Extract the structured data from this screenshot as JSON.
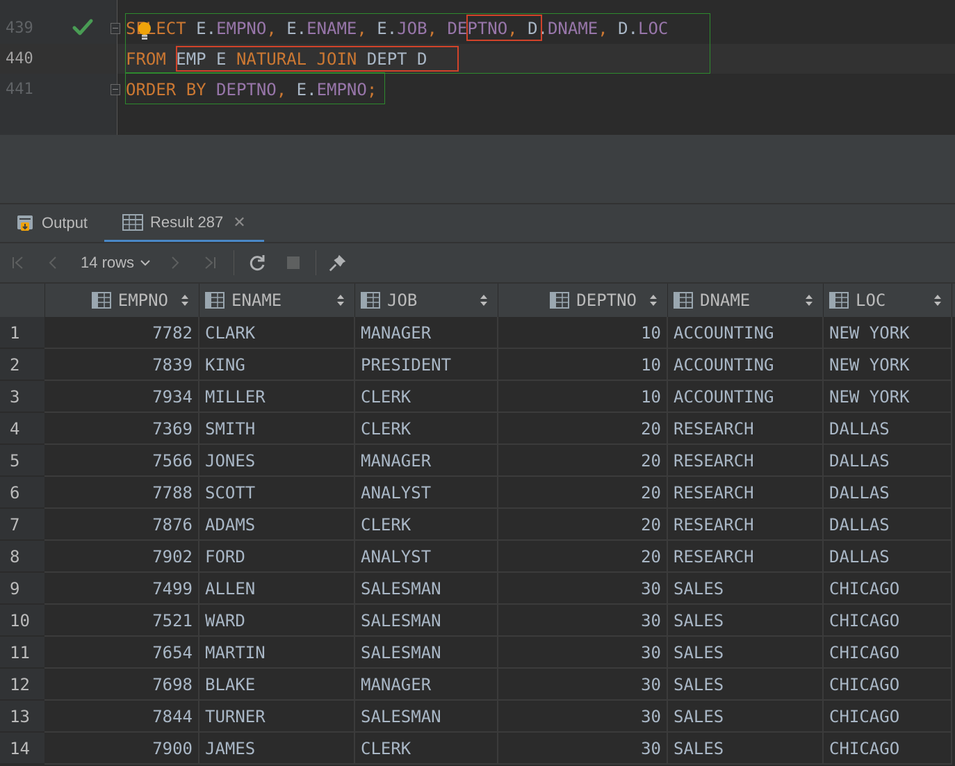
{
  "editor": {
    "line_numbers": [
      "439",
      "440",
      "441"
    ],
    "current_line": "440",
    "code": {
      "line1": [
        {
          "t": "SELECT",
          "c": "kw"
        },
        {
          "t": " ",
          "c": "plain"
        },
        {
          "t": "E",
          "c": "plain"
        },
        {
          "t": ".",
          "c": "plain"
        },
        {
          "t": "EMPNO",
          "c": "id"
        },
        {
          "t": ", ",
          "c": "kw"
        },
        {
          "t": "E",
          "c": "plain"
        },
        {
          "t": ".",
          "c": "plain"
        },
        {
          "t": "ENAME",
          "c": "id"
        },
        {
          "t": ", ",
          "c": "kw"
        },
        {
          "t": "E",
          "c": "plain"
        },
        {
          "t": ".",
          "c": "plain"
        },
        {
          "t": "JOB",
          "c": "id"
        },
        {
          "t": ", ",
          "c": "kw"
        },
        {
          "t": "DEPTNO",
          "c": "id"
        },
        {
          "t": ", ",
          "c": "kw"
        },
        {
          "t": "D",
          "c": "plain"
        },
        {
          "t": ".",
          "c": "plain"
        },
        {
          "t": "DNAME",
          "c": "id"
        },
        {
          "t": ", ",
          "c": "kw"
        },
        {
          "t": "D",
          "c": "plain"
        },
        {
          "t": ".",
          "c": "plain"
        },
        {
          "t": "LOC",
          "c": "id"
        }
      ],
      "line2": [
        {
          "t": "FROM",
          "c": "kw"
        },
        {
          "t": " ",
          "c": "plain"
        },
        {
          "t": "EMP E ",
          "c": "plain"
        },
        {
          "t": "NATURAL JOIN",
          "c": "kw"
        },
        {
          "t": " DEPT D",
          "c": "plain"
        }
      ],
      "line3": [
        {
          "t": "ORDER BY",
          "c": "kw"
        },
        {
          "t": " ",
          "c": "plain"
        },
        {
          "t": "DEPTNO",
          "c": "id"
        },
        {
          "t": ", ",
          "c": "kw"
        },
        {
          "t": "E",
          "c": "plain"
        },
        {
          "t": ".",
          "c": "plain"
        },
        {
          "t": "EMPNO",
          "c": "id"
        },
        {
          "t": ";",
          "c": "kw"
        }
      ]
    }
  },
  "tabs": {
    "output_label": "Output",
    "result_label": "Result 287"
  },
  "toolbar": {
    "rows_label": "14 rows"
  },
  "grid": {
    "columns": [
      "EMPNO",
      "ENAME",
      "JOB",
      "DEPTNO",
      "DNAME",
      "LOC"
    ],
    "rows": [
      [
        "1",
        "7782",
        "CLARK",
        "MANAGER",
        "10",
        "ACCOUNTING",
        "NEW YORK"
      ],
      [
        "2",
        "7839",
        "KING",
        "PRESIDENT",
        "10",
        "ACCOUNTING",
        "NEW YORK"
      ],
      [
        "3",
        "7934",
        "MILLER",
        "CLERK",
        "10",
        "ACCOUNTING",
        "NEW YORK"
      ],
      [
        "4",
        "7369",
        "SMITH",
        "CLERK",
        "20",
        "RESEARCH",
        "DALLAS"
      ],
      [
        "5",
        "7566",
        "JONES",
        "MANAGER",
        "20",
        "RESEARCH",
        "DALLAS"
      ],
      [
        "6",
        "7788",
        "SCOTT",
        "ANALYST",
        "20",
        "RESEARCH",
        "DALLAS"
      ],
      [
        "7",
        "7876",
        "ADAMS",
        "CLERK",
        "20",
        "RESEARCH",
        "DALLAS"
      ],
      [
        "8",
        "7902",
        "FORD",
        "ANALYST",
        "20",
        "RESEARCH",
        "DALLAS"
      ],
      [
        "9",
        "7499",
        "ALLEN",
        "SALESMAN",
        "30",
        "SALES",
        "CHICAGO"
      ],
      [
        "10",
        "7521",
        "WARD",
        "SALESMAN",
        "30",
        "SALES",
        "CHICAGO"
      ],
      [
        "11",
        "7654",
        "MARTIN",
        "SALESMAN",
        "30",
        "SALES",
        "CHICAGO"
      ],
      [
        "12",
        "7698",
        "BLAKE",
        "MANAGER",
        "30",
        "SALES",
        "CHICAGO"
      ],
      [
        "13",
        "7844",
        "TURNER",
        "SALESMAN",
        "30",
        "SALES",
        "CHICAGO"
      ],
      [
        "14",
        "7900",
        "JAMES",
        "CLERK",
        "30",
        "SALES",
        "CHICAGO"
      ]
    ]
  },
  "colors": {
    "keyword": "#cc7832",
    "identifier": "#9876aa",
    "plain": "#a9b7c6",
    "check": "#499c54",
    "highlight_red": "#d1432a",
    "highlight_green": "#2e8a2e"
  },
  "icons": {
    "check": "check-icon",
    "bulb": "lightbulb-icon",
    "output": "output-icon",
    "result": "table-icon",
    "first": "first-page-icon",
    "prev": "prev-page-icon",
    "next": "next-page-icon",
    "last": "last-page-icon",
    "refresh": "refresh-icon",
    "stop": "stop-icon",
    "pin": "pin-icon",
    "column": "column-icon",
    "sort": "sort-icon"
  }
}
